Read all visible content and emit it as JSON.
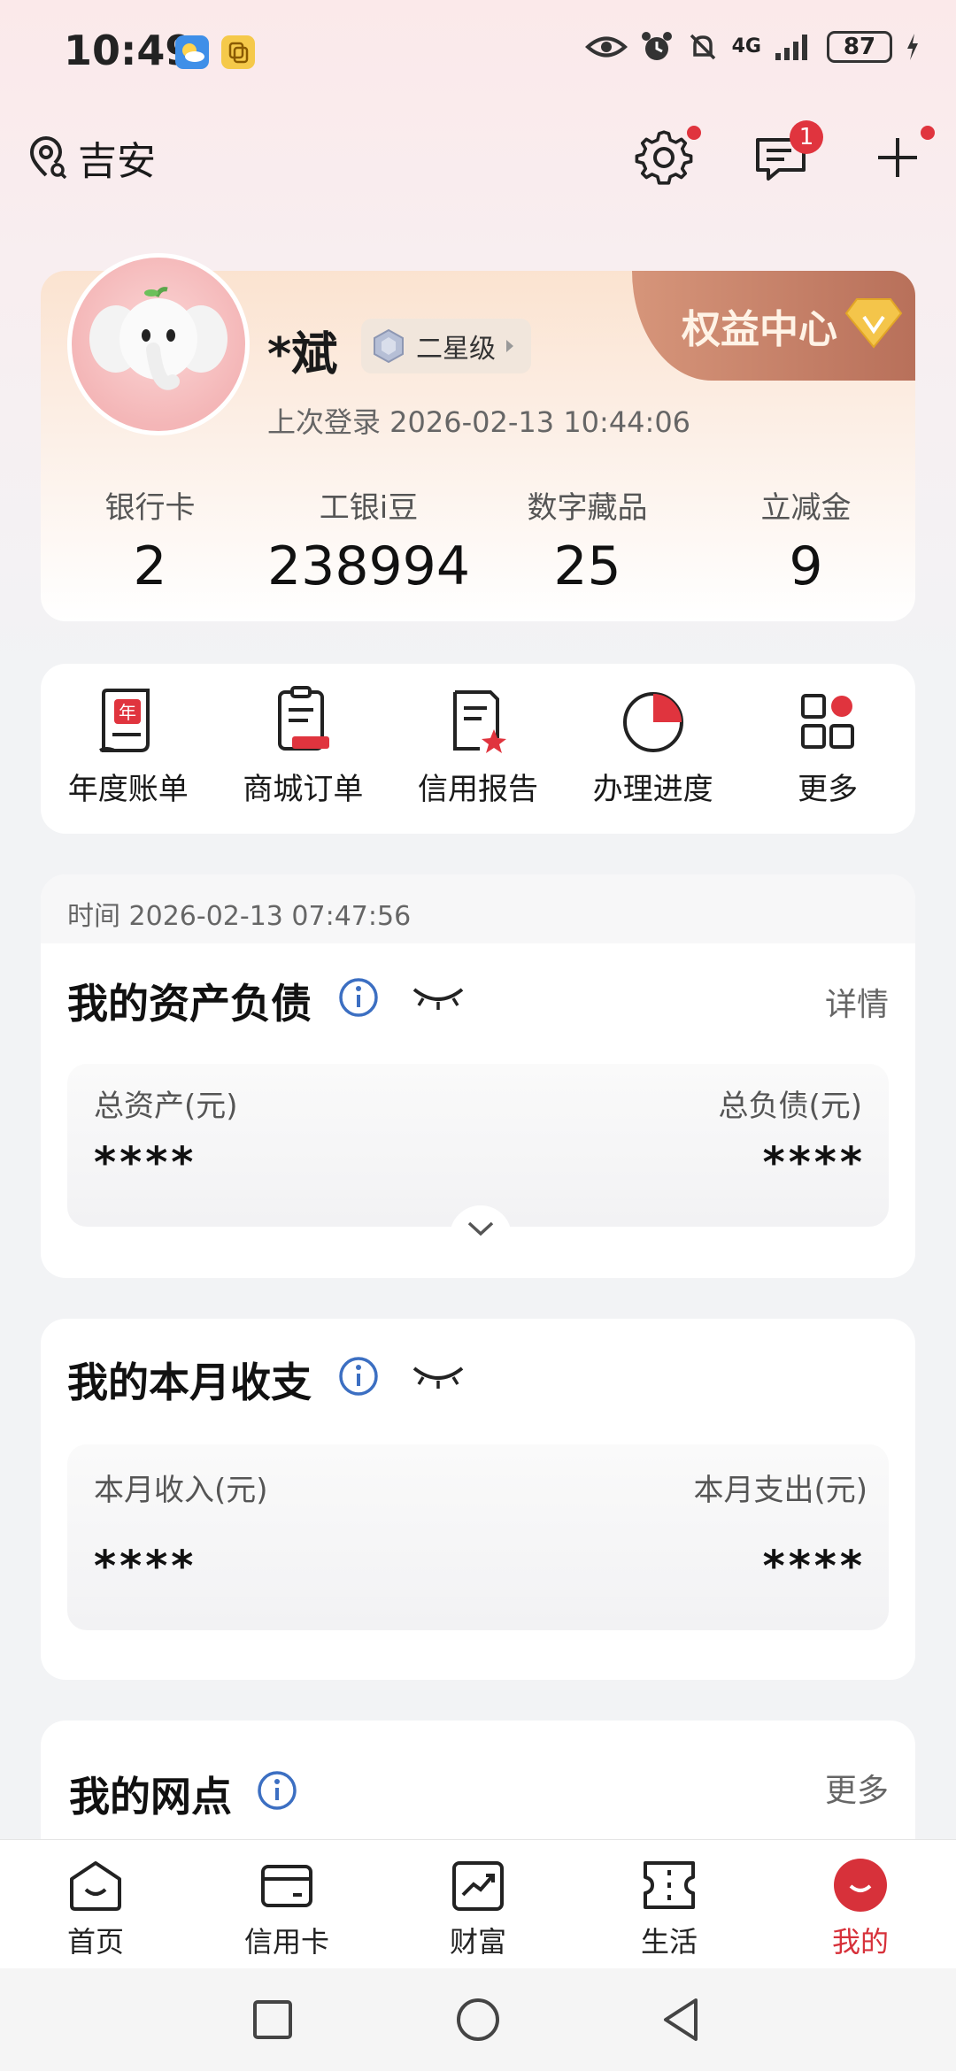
{
  "status_bar": {
    "time": "10:49",
    "network": "4G",
    "battery": "87"
  },
  "header": {
    "location": "吉安",
    "message_badge": "1"
  },
  "profile": {
    "name": "*斌",
    "level": "二星级",
    "benefit_center": "权益中心",
    "last_login": "上次登录 2026-02-13 10:44:06",
    "stats": [
      {
        "label": "银行卡",
        "value": "2"
      },
      {
        "label": "工银i豆",
        "value": "238994"
      },
      {
        "label": "数字藏品",
        "value": "25"
      },
      {
        "label": "立减金",
        "value": "9"
      }
    ]
  },
  "quick_actions": [
    {
      "label": "年度账单",
      "icon": "annual-bill-icon"
    },
    {
      "label": "商城订单",
      "icon": "mall-order-icon"
    },
    {
      "label": "信用报告",
      "icon": "credit-report-icon"
    },
    {
      "label": "办理进度",
      "icon": "progress-icon"
    },
    {
      "label": "更多",
      "icon": "more-grid-icon"
    }
  ],
  "assets": {
    "time": "时间 2026-02-13 07:47:56",
    "title": "我的资产负债",
    "detail": "详情",
    "total_assets_label": "总资产(元)",
    "total_assets_value": "****",
    "total_debt_label": "总负债(元)",
    "total_debt_value": "****"
  },
  "monthly": {
    "title": "我的本月收支",
    "income_label": "本月收入(元)",
    "income_value": "****",
    "expense_label": "本月支出(元)",
    "expense_value": "****"
  },
  "branch": {
    "title": "我的网点",
    "more": "更多"
  },
  "bottom_nav": [
    {
      "label": "首页"
    },
    {
      "label": "信用卡"
    },
    {
      "label": "财富"
    },
    {
      "label": "生活"
    },
    {
      "label": "我的"
    }
  ],
  "colors": {
    "accent_red": "#d7313a",
    "badge_red": "#e0343e",
    "info_blue": "#3c6fc2"
  }
}
